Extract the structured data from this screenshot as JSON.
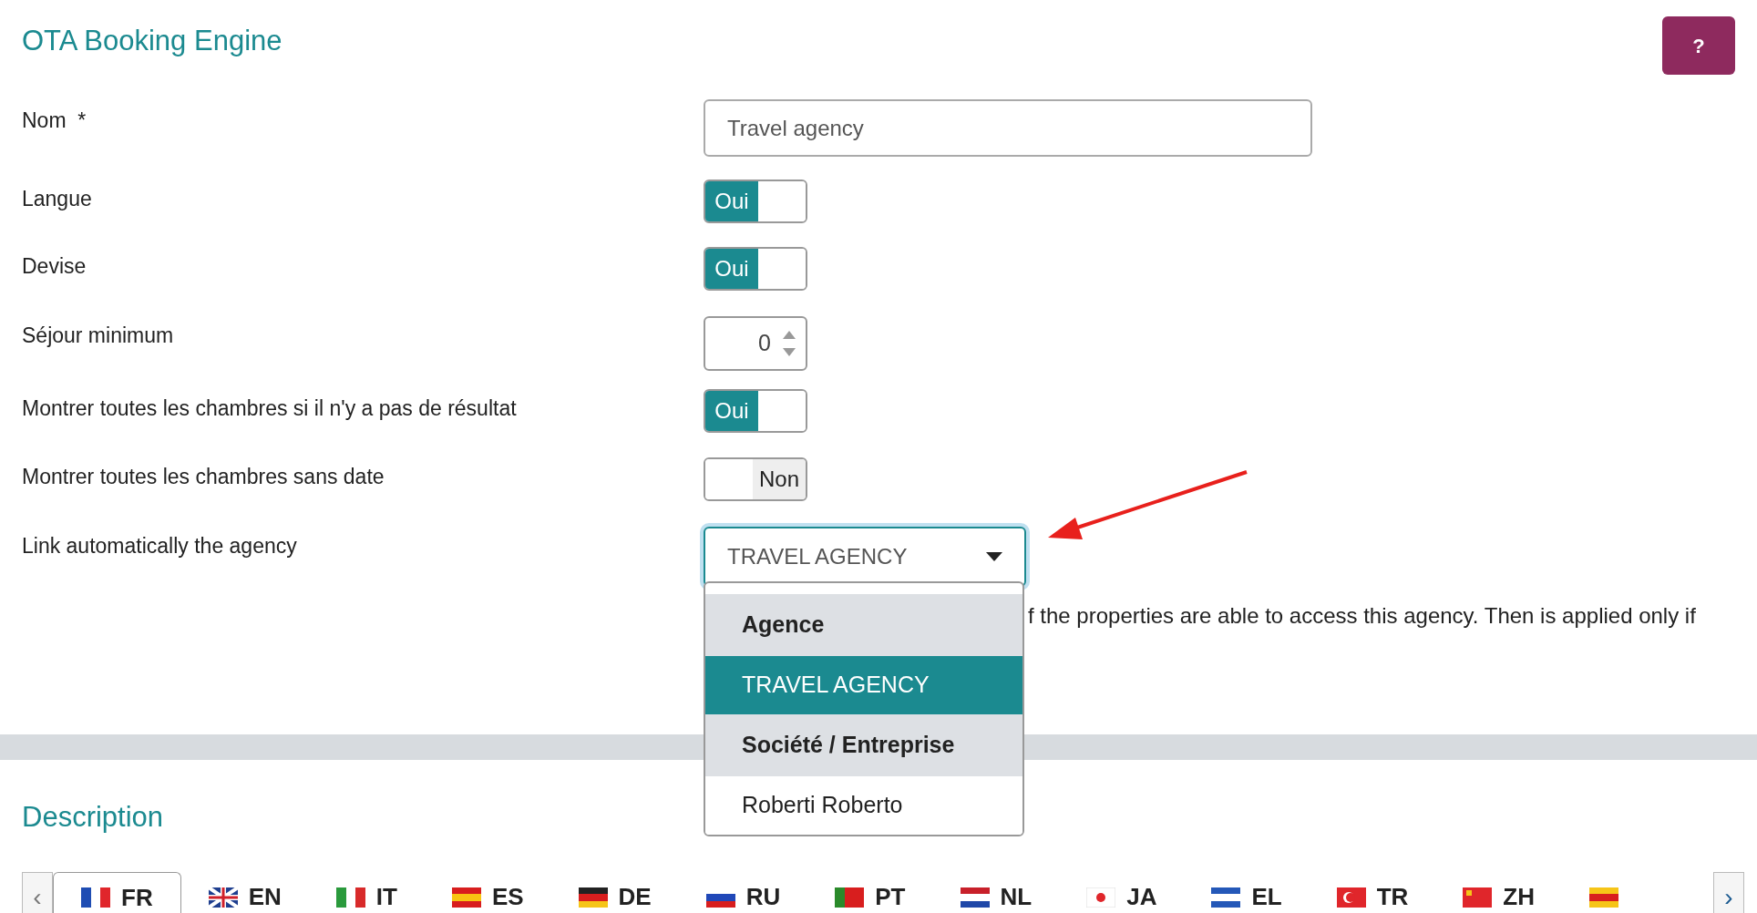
{
  "title": "OTA Booking Engine",
  "help_button": "?",
  "fields": [
    {
      "kind": "text",
      "label": "Nom  *",
      "value": "Travel agency"
    },
    {
      "kind": "toggle",
      "label": "Langue",
      "on": true,
      "text": "Oui"
    },
    {
      "kind": "toggle",
      "label": "Devise",
      "on": true,
      "text": "Oui"
    },
    {
      "kind": "number",
      "label": "Séjour minimum",
      "value": "0"
    },
    {
      "kind": "toggle",
      "label": "Montrer toutes les chambres si il n'y a pas de résultat",
      "on": true,
      "text": "Oui"
    },
    {
      "kind": "toggle",
      "label": "Montrer toutes les chambres sans date",
      "on": false,
      "text": "Non"
    },
    {
      "kind": "select",
      "label": "Link automatically the agency",
      "value": "TRAVEL AGENCY",
      "expanded": true
    }
  ],
  "dropdown": [
    {
      "kind": "group",
      "label": "Agence",
      "selected": false
    },
    {
      "kind": "option",
      "label": "TRAVEL AGENCY",
      "selected": true
    },
    {
      "kind": "group",
      "label": "Société / Entreprise",
      "selected": false
    },
    {
      "kind": "option",
      "label": "Roberti Roberto",
      "selected": false
    }
  ],
  "help_text": "f the properties are able to access this agency. Then is applied only if",
  "description": {
    "title": "Description",
    "tabs": [
      {
        "code": "FR",
        "selected": true
      },
      {
        "code": "EN",
        "selected": false
      },
      {
        "code": "IT",
        "selected": false
      },
      {
        "code": "ES",
        "selected": false
      },
      {
        "code": "DE",
        "selected": false
      },
      {
        "code": "RU",
        "selected": false
      },
      {
        "code": "PT",
        "selected": false
      },
      {
        "code": "NL",
        "selected": false
      },
      {
        "code": "JA",
        "selected": false
      },
      {
        "code": "EL",
        "selected": false
      },
      {
        "code": "TR",
        "selected": false
      },
      {
        "code": "ZH",
        "selected": false
      },
      {
        "selected": false
      }
    ],
    "prev": "‹",
    "next": "›"
  }
}
